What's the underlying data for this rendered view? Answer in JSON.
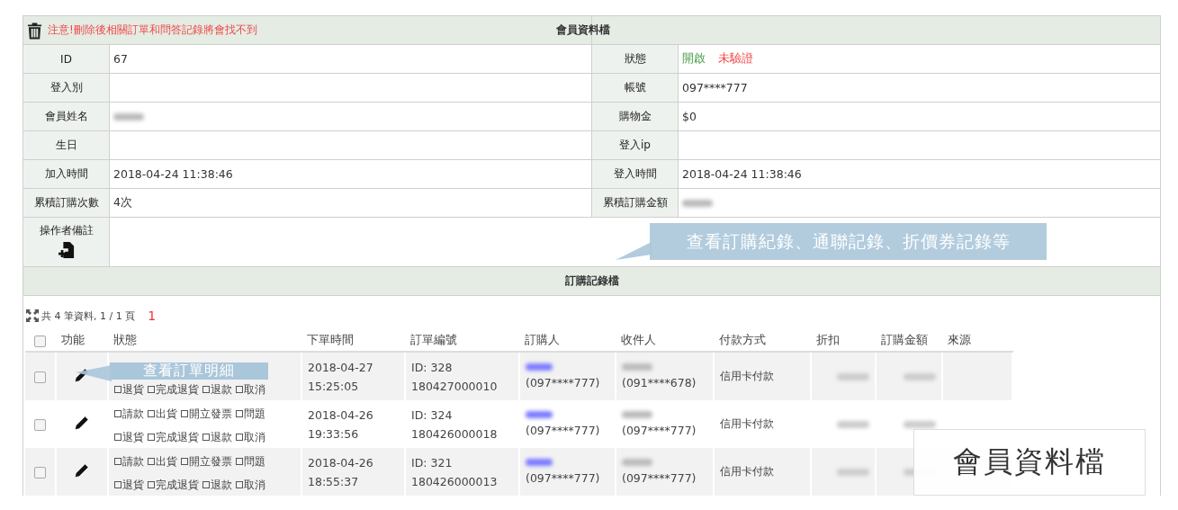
{
  "member_panel": {
    "warning": "注意!刪除後相關訂單和問答記錄將會找不到",
    "title": "會員資料檔",
    "rows": [
      {
        "left": {
          "label": "ID",
          "kind": "text",
          "value": "67"
        },
        "right": {
          "label": "狀態",
          "kind": "tags",
          "tags": [
            {
              "text": "開啟",
              "color": "#4a9e4a"
            },
            {
              "text": "未驗證",
              "color": "#f04a4a"
            }
          ]
        }
      },
      {
        "left": {
          "label": "登入別",
          "kind": "empty"
        },
        "right": {
          "label": "帳號",
          "kind": "text",
          "value": "097****777"
        }
      },
      {
        "left": {
          "label": "會員姓名",
          "kind": "redacted"
        },
        "right": {
          "label": "購物金",
          "kind": "text",
          "value": "$0"
        }
      },
      {
        "left": {
          "label": "生日",
          "kind": "empty"
        },
        "right": {
          "label": "登入ip",
          "kind": "empty"
        }
      },
      {
        "left": {
          "label": "加入時間",
          "kind": "text",
          "value": "2018-04-24 11:38:46"
        },
        "right": {
          "label": "登入時間",
          "kind": "text",
          "value": "2018-04-24 11:38:46"
        }
      },
      {
        "left": {
          "label": "累積訂購次數",
          "kind": "text",
          "value": "4次"
        },
        "right": {
          "label": "累積訂購金額",
          "kind": "redacted"
        }
      }
    ],
    "note_label": "操作者備註"
  },
  "orders": {
    "title": "訂購記錄檔",
    "summary": "共 4 筆資料, 1 / 1 頁",
    "current_page": "1",
    "columns": [
      "功能",
      "狀態",
      "下單時間",
      "訂單編號",
      "訂購人",
      "收件人",
      "付款方式",
      "折扣",
      "訂購金額",
      "來源"
    ],
    "select_all_checked": false,
    "rows": [
      {
        "checked": false,
        "status_options": [
          {
            "label": "退貨",
            "checked": false
          },
          {
            "label": "完成退貨",
            "checked": false
          },
          {
            "label": "退款",
            "checked": false
          },
          {
            "label": "取消",
            "checked": false
          }
        ],
        "date": "2018-04-27",
        "time": "15:25:05",
        "order_id": "ID: 328",
        "order_number": "180427000010",
        "buyer_phone": "(097****777)",
        "receiver_phone": "(091****678)",
        "payment": "信用卡付款"
      },
      {
        "checked": false,
        "status_options": [
          {
            "label": "請款",
            "checked": false
          },
          {
            "label": "出貨",
            "checked": false
          },
          {
            "label": "開立發票",
            "checked": false
          },
          {
            "label": "問題",
            "checked": false
          },
          {
            "label": "退貨",
            "checked": false
          },
          {
            "label": "完成退貨",
            "checked": false
          },
          {
            "label": "退款",
            "checked": false
          },
          {
            "label": "取消",
            "checked": false
          }
        ],
        "date": "2018-04-26",
        "time": "19:33:56",
        "order_id": "ID: 324",
        "order_number": "180426000018",
        "buyer_phone": "(097****777)",
        "receiver_phone": "(097****777)",
        "payment": "信用卡付款"
      },
      {
        "checked": false,
        "status_options": [
          {
            "label": "請款",
            "checked": false
          },
          {
            "label": "出貨",
            "checked": false
          },
          {
            "label": "開立發票",
            "checked": false
          },
          {
            "label": "問題",
            "checked": false
          },
          {
            "label": "退貨",
            "checked": false
          },
          {
            "label": "完成退貨",
            "checked": false
          },
          {
            "label": "退款",
            "checked": false
          },
          {
            "label": "取消",
            "checked": false
          }
        ],
        "date": "2018-04-26",
        "time": "18:55:37",
        "order_id": "ID: 321",
        "order_number": "180426000013",
        "buyer_phone": "(097****777)",
        "receiver_phone": "(097****777)",
        "payment": "信用卡付款"
      }
    ]
  },
  "callouts": [
    {
      "text": "查看訂購紀錄、通聯記錄、折價券記錄等"
    },
    {
      "text": "查看訂單明細"
    }
  ],
  "caption": "會員資料檔"
}
